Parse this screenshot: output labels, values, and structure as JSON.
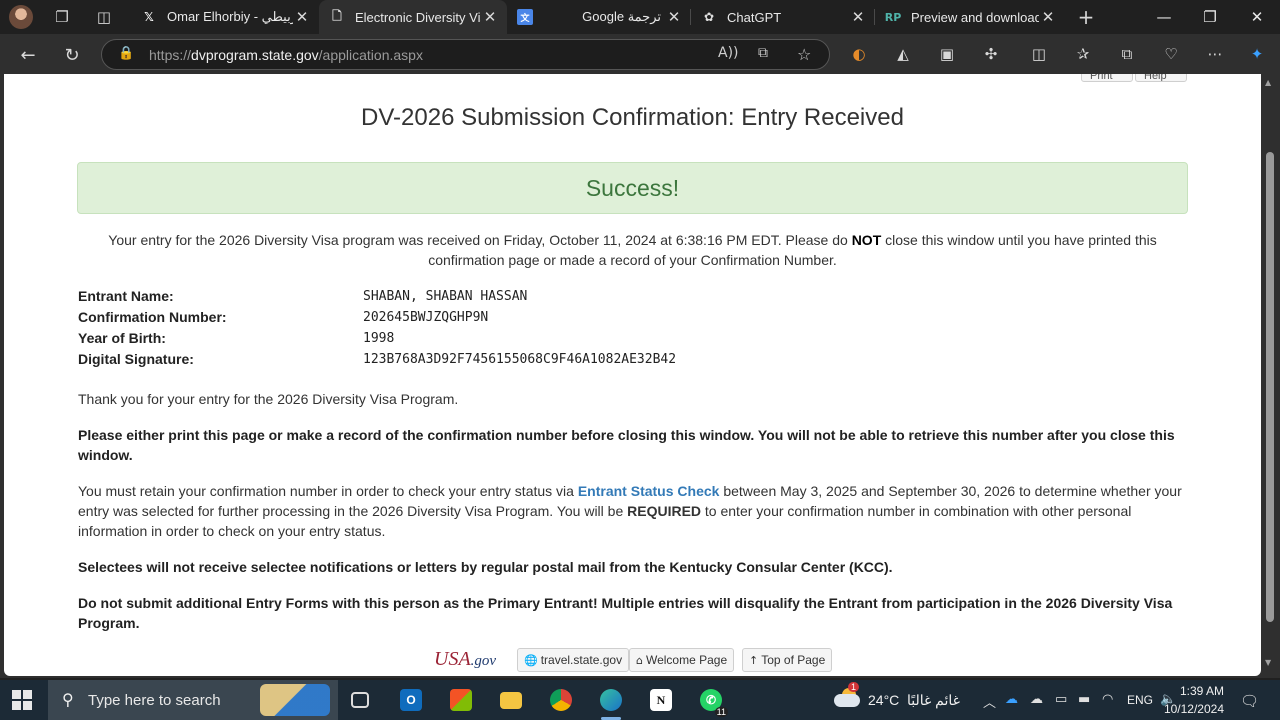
{
  "browser": {
    "tabs": [
      {
        "favicon": "x-logo",
        "title": "Omar Elhorbiy - ‏الحربيطي",
        "active": false
      },
      {
        "favicon": "document-icon",
        "title": "Electronic Diversity Visa",
        "active": true
      },
      {
        "favicon": "translate-icon",
        "title": "Google ترجمة",
        "active": false
      },
      {
        "favicon": "chatgpt-logo",
        "title": "ChatGPT",
        "active": false
      },
      {
        "favicon": "rp-logo",
        "favicon_text": "RP",
        "title": "Preview and download",
        "active": false
      }
    ],
    "url_scheme": "https://",
    "url_host": "dvprogram.state.gov",
    "url_path": "/application.aspx",
    "accent": "#7fb2e5"
  },
  "page": {
    "top_buttons": [
      "Print",
      "Help"
    ],
    "title": "DV-2026 Submission Confirmation: Entry Received",
    "success": "Success!",
    "received": {
      "text1": "Your entry for the 2026 Diversity Visa program was received on Friday, October 11, 2024 at 6:38:16 PM EDT. Please do ",
      "emph": "NOT",
      "text2": " close this window until you have printed this confirmation page or made a record of your Confirmation Number."
    },
    "info": [
      {
        "label": "Entrant Name:",
        "value": "SHABAN, SHABAN HASSAN"
      },
      {
        "label": "Confirmation Number:",
        "value": "202645BWJZQGHP9N"
      },
      {
        "label": "Year of Birth:",
        "value": "1998"
      },
      {
        "label": "Digital Signature:",
        "value": "123B768A3D92F7456155068C9F46A1082AE32B42"
      }
    ],
    "thank_you": "Thank you for your entry for the 2026 Diversity Visa Program.",
    "print_notice": "Please either print this page or make a record of the confirmation number before closing this window. You will not be able to retrieve this number after you close this window.",
    "retain": {
      "text1": "You must retain your confirmation number in order to check your entry status via ",
      "link": "Entrant Status Check",
      "text2": " between May 3, 2025 and September 30, 2026 to determine whether your entry was selected for further processing in the 2026 Diversity Visa Program. You will be ",
      "emph": "REQUIRED",
      "text3": " to enter your confirmation number in combination with other personal information in order to check on your entry status."
    },
    "selectees_notice": "Selectees will not receive selectee notifications or letters by regular postal mail from the Kentucky Consular Center (KCC).",
    "multiple_entries_notice": "Do not submit additional Entry Forms with this person as the Primary Entrant! Multiple entries will disqualify the Entrant from participation in the 2026 Diversity Visa Program.",
    "footer": {
      "logo_main": "USA",
      "logo_suffix": ".gov",
      "links": [
        "travel.state.gov",
        "Welcome Page",
        "Top of Page"
      ]
    },
    "colors": {
      "success_bg": "#dff0d8",
      "success_text": "#3c763d",
      "link": "#337ab7"
    }
  },
  "taskbar": {
    "search_placeholder": "Type here to search",
    "whatsapp_badge": "11",
    "weather_badge": "1",
    "temperature": "24°C",
    "weather_text": "غائم غالبًا",
    "language": "ENG",
    "time": "1:39 AM",
    "date": "10/12/2024"
  }
}
